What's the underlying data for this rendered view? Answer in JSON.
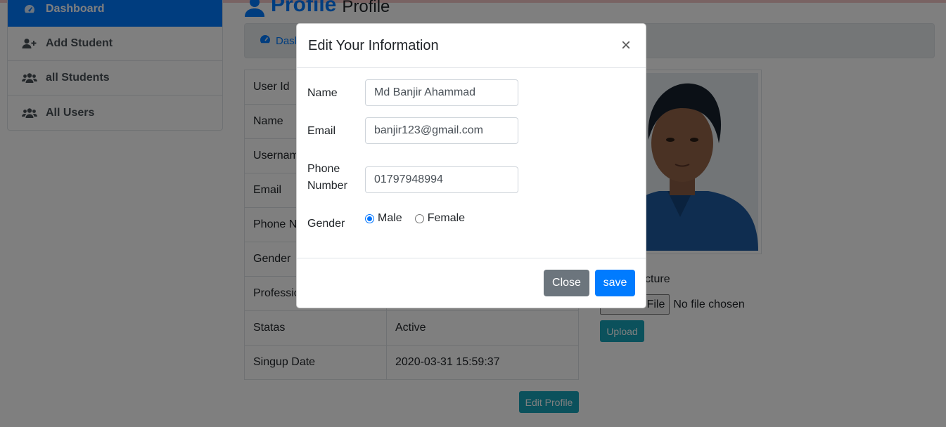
{
  "colors": {
    "primary": "#007bff",
    "info": "#17a2b8",
    "secondary": "#6c757d"
  },
  "sidebar": {
    "items": [
      {
        "label": "Dashboard",
        "icon": "tachometer-icon",
        "active": true
      },
      {
        "label": "Add Student",
        "icon": "user-plus-icon"
      },
      {
        "label": "all Students",
        "icon": "users-icon"
      },
      {
        "label": "All Users",
        "icon": "users-icon"
      }
    ]
  },
  "page": {
    "title_strong": "Profile",
    "title_light": "Profile",
    "breadcrumb": "Dashboard"
  },
  "profile_table": {
    "rows": [
      {
        "key": "User Id",
        "value": ""
      },
      {
        "key": "Name",
        "value": ""
      },
      {
        "key": "Username",
        "value": ""
      },
      {
        "key": "Email",
        "value": ""
      },
      {
        "key": "Phone Number",
        "value": ""
      },
      {
        "key": "Gender",
        "value": ""
      },
      {
        "key": "Profession",
        "value": ""
      },
      {
        "key": "Statas",
        "value": "Active"
      },
      {
        "key": "Singup Date",
        "value": "2020-03-31 15:59:37"
      }
    ],
    "edit_label": "Edit Profile"
  },
  "picture": {
    "label": "Profile Picture",
    "choose_label": "Choose File",
    "no_file": "No file chosen",
    "upload_label": "Upload"
  },
  "modal": {
    "title": "Edit Your Information",
    "close_symbol": "×",
    "name_label": "Name",
    "name_value": "Md Banjir Ahammad",
    "email_label": "Email",
    "email_value": "banjir123@gmail.com",
    "phone_label_1": "Phone",
    "phone_label_2": "Number",
    "phone_value": "01797948994",
    "gender_label": "Gender",
    "gender_options": [
      "Male",
      "Female"
    ],
    "gender_selected": "Male",
    "close_label": "Close",
    "save_label": "save"
  }
}
